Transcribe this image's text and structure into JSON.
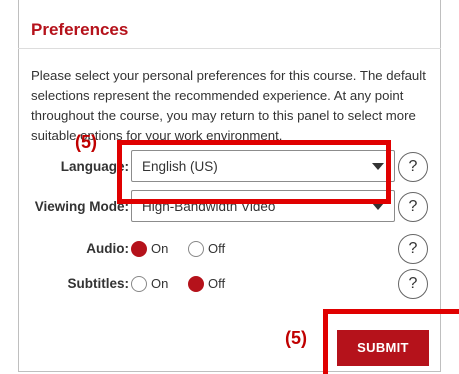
{
  "panel": {
    "title": "Preferences",
    "description": "Please select your personal preferences for this course. The default selections represent the recommended experience. At any point throughout the course, you may return to this panel to select more suitable options for your work environment."
  },
  "fields": {
    "language": {
      "label": "Language:",
      "value": "English (US)",
      "help": "?"
    },
    "viewing_mode": {
      "label": "Viewing Mode:",
      "value": "High-Bandwidth Video",
      "help": "?"
    },
    "audio": {
      "label": "Audio:",
      "on_label": "On",
      "off_label": "Off",
      "selected": "On",
      "help": "?"
    },
    "subtitles": {
      "label": "Subtitles:",
      "on_label": "On",
      "off_label": "Off",
      "selected": "Off",
      "help": "?"
    }
  },
  "actions": {
    "submit_label": "SUBMIT"
  },
  "annotations": {
    "callout_language": "(5)",
    "callout_submit": "(5)",
    "highlight_color": "#e00000"
  },
  "colors": {
    "accent": "#b5121b"
  }
}
